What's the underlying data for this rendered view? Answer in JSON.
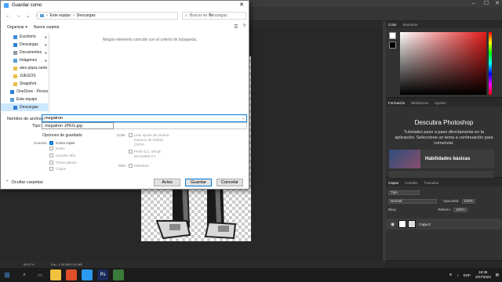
{
  "dialog": {
    "title": "Guardar como",
    "close_glyph": "✕",
    "address": {
      "root": "Este equipo",
      "separator": "›",
      "folder": "Descargas"
    },
    "search_placeholder": "Buscar en Descargas",
    "toolbar": {
      "organize": "Organizar ▾",
      "new_folder": "Nueva carpeta"
    },
    "nav_items": [
      {
        "label": "Escritorio",
        "icon_color": "#3c8bd9",
        "pinned": true
      },
      {
        "label": "Descargas",
        "icon_color": "#2f7fd1",
        "pinned": true
      },
      {
        "label": "Documentos",
        "icon_color": "#8c9aa8",
        "pinned": true
      },
      {
        "label": "Imágenes",
        "icon_color": "#5aa0d8",
        "pinned": true
      },
      {
        "label": "alex plaza norte",
        "icon_color": "#e8c04a",
        "pinned": false
      },
      {
        "label": "JUEGOS",
        "icon_color": "#e8c04a",
        "pinned": false
      },
      {
        "label": "Snapshot",
        "icon_color": "#e8c04a",
        "pinned": false
      },
      {
        "label": "OneDrive - Persor",
        "icon_color": "#2b7fd4",
        "pinned": false
      },
      {
        "label": "Este equipo",
        "icon_color": "#5aa0d8",
        "pinned": false
      },
      {
        "label": "Descargas",
        "icon_color": "#2f7fd1",
        "pinned": false,
        "selected": true
      }
    ],
    "empty_message": "Ningún elemento coincide con el criterio de búsqueda.",
    "filename_label": "Nombre de archivo:",
    "filename_value": "megatron",
    "type_label": "Tipo:",
    "type_option": "megatron JPEG.jpg",
    "options_heading": "Opciones de guardado",
    "save_label": "Guardar:",
    "save_copy": "Como copia",
    "notes": "Notas",
    "alpha": "Canales alfa",
    "spot": "Tintas planas",
    "layers": "Capas",
    "color_label": "Color:",
    "proof": "Usar ajuste de prueba:",
    "proof_sub1": "Espacio de trabajo",
    "proof_sub2": "CMYK",
    "icc": "Perfil ICC: sRGB",
    "icc_sub": "IEC61966-2.1",
    "other_label": "Otro:",
    "thumbnail": "Miniatura",
    "hide_folders": "Ocultar carpetas",
    "buttons": {
      "warning": "Aviso",
      "save": "Guardar",
      "cancel": "Cancelar"
    }
  },
  "photoshop": {
    "color_tabs": [
      "Color",
      "Muestras"
    ],
    "learn_tabs": [
      "Formación",
      "Bibliotecas",
      "Ajustes"
    ],
    "learn_title": "Descubra Photoshop",
    "learn_body": "Tutoriales paso a paso directamente en la aplicación. Seleccione un tema a continuación para comenzar.",
    "learn_card": "Habilidades básicas",
    "layer_tabs": [
      "Capas",
      "Canales",
      "Trazados"
    ],
    "kind": "Tipo",
    "blend": "Normal",
    "opacity_label": "Opacidad:",
    "opacity": "100%",
    "lock_label": "Bloq.:",
    "fill_label": "Relleno:",
    "fill": "100%",
    "layer_name": "Capa 0",
    "zoom": "66,67%",
    "doc_info": "Doc: 1,36 MB/1,84 MB"
  },
  "taskbar": {
    "lang": "ESP",
    "time": "18:38",
    "date": "1/07/2023",
    "app_colors": [
      "#f0c040",
      "#e04e2a",
      "#2a9af0",
      "#1a2a5a",
      "#3a7a3a"
    ],
    "app_labels": [
      "",
      "",
      "",
      "Ps",
      ""
    ]
  }
}
